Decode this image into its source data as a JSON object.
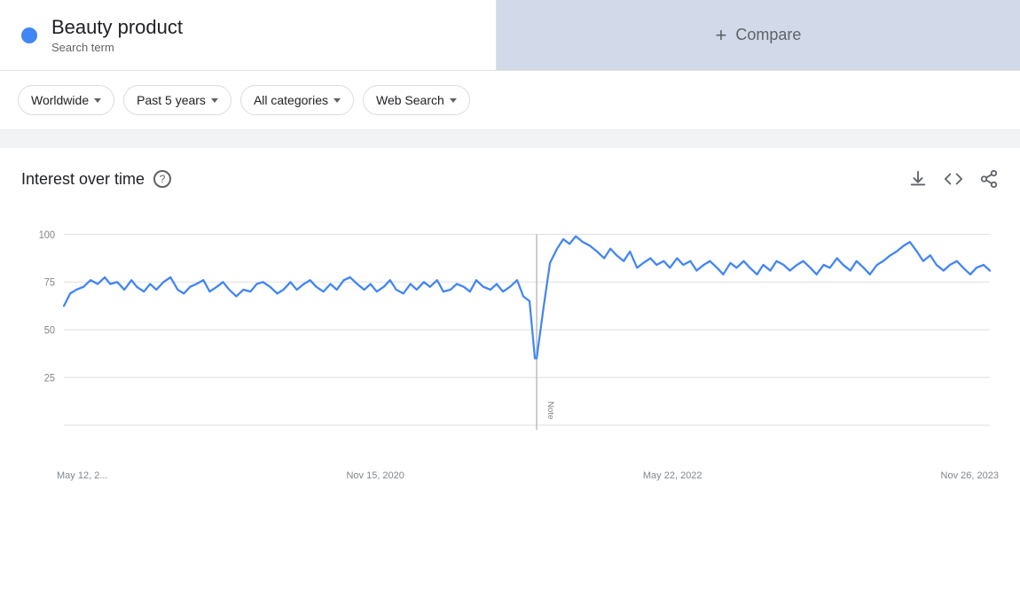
{
  "header": {
    "term": {
      "name": "Beauty product",
      "type": "Search term",
      "dot_color": "#4285f4"
    },
    "compare_label": "Compare",
    "compare_plus": "+"
  },
  "filters": [
    {
      "id": "region",
      "label": "Worldwide"
    },
    {
      "id": "time",
      "label": "Past 5 years"
    },
    {
      "id": "category",
      "label": "All categories"
    },
    {
      "id": "search_type",
      "label": "Web Search"
    }
  ],
  "chart": {
    "title": "Interest over time",
    "help_icon": "?",
    "y_labels": [
      "100",
      "75",
      "50",
      "25"
    ],
    "x_labels": [
      "May 12, 2...",
      "Nov 15, 2020",
      "May 22, 2022",
      "Nov 26, 2023"
    ],
    "note_label": "Note",
    "actions": {
      "download": "download-icon",
      "embed": "embed-icon",
      "share": "share-icon"
    }
  }
}
